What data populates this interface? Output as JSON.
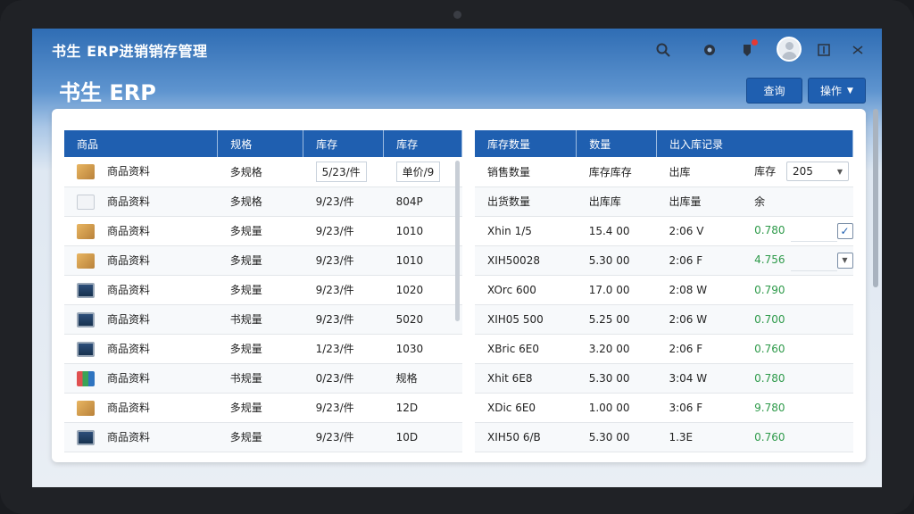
{
  "app_title": "书生 ERP进销销存管理",
  "brand": "书生 ERP",
  "buttons": {
    "query": "查询",
    "action": "操作"
  },
  "left_table": {
    "headers": [
      "商品",
      "规格",
      "库存",
      "库存"
    ],
    "rows": [
      {
        "icon": "box-icon",
        "name": "商品资料",
        "spec": "多规格",
        "stock": "5/23/件",
        "price": "单价/9"
      },
      {
        "icon": "document-icon",
        "name": "商品资料",
        "spec": "多规格",
        "stock": "9/23/件",
        "price": "804P"
      },
      {
        "icon": "box-icon",
        "name": "商品资料",
        "spec": "多规量",
        "stock": "9/23/件",
        "price": "1010"
      },
      {
        "icon": "box-icon",
        "name": "商品资料",
        "spec": "多规量",
        "stock": "9/23/件",
        "price": "1010"
      },
      {
        "icon": "monitor-icon",
        "name": "商品资料",
        "spec": "多规量",
        "stock": "9/23/件",
        "price": "1020"
      },
      {
        "icon": "monitor-icon",
        "name": "商品资料",
        "spec": "书规量",
        "stock": "9/23/件",
        "price": "5020"
      },
      {
        "icon": "monitor-icon",
        "name": "商品资料",
        "spec": "多规量",
        "stock": "1/23/件",
        "price": "1030"
      },
      {
        "icon": "chart-icon",
        "name": "商品资料",
        "spec": "书规量",
        "stock": "0/23/件",
        "price": "规格"
      },
      {
        "icon": "box-icon",
        "name": "商品资料",
        "spec": "多规量",
        "stock": "9/23/件",
        "price": "12D"
      },
      {
        "icon": "monitor-icon",
        "name": "商品资料",
        "spec": "多规量",
        "stock": "9/23/件",
        "price": "10D"
      }
    ]
  },
  "right_table": {
    "headers": [
      "库存数量",
      "数量",
      "出入库记录"
    ],
    "sub_row_1": {
      "a": "销售数量",
      "b": "库存库存",
      "c": "出库",
      "label": "库存",
      "select": "205"
    },
    "sub_row_2": {
      "a": "出货数量",
      "b": "出库库",
      "c": "出库量",
      "d": "余"
    },
    "rows": [
      {
        "a": "Xhin 1/5",
        "b": "15.4 00",
        "c": "2:06 V",
        "d": "0.780",
        "checked": true
      },
      {
        "a": "XIH50028",
        "b": "5.30 00",
        "c": "2:06 F",
        "d": "4.756",
        "checked": false
      },
      {
        "a": "XOrc 600",
        "b": "17.0 00",
        "c": "2:08 W",
        "d": "0.790"
      },
      {
        "a": "XIH05 500",
        "b": "5.25 00",
        "c": "2:06 W",
        "d": "0.700"
      },
      {
        "a": "XBric 6E0",
        "b": "3.20 00",
        "c": "2:06 F",
        "d": "0.760"
      },
      {
        "a": "Xhit 6E8",
        "b": "5.30 00",
        "c": "3:04 W",
        "d": "0.780"
      },
      {
        "a": "XDic 6E0",
        "b": "1.00 00",
        "c": "3:06 F",
        "d": "9.780"
      },
      {
        "a": "XIH50 6/B",
        "b": "5.30 00",
        "c": "1.3E",
        "d": "0.760"
      }
    ]
  },
  "colors": {
    "header": "#1f5fb0",
    "accent_green": "#2e9a4a"
  }
}
